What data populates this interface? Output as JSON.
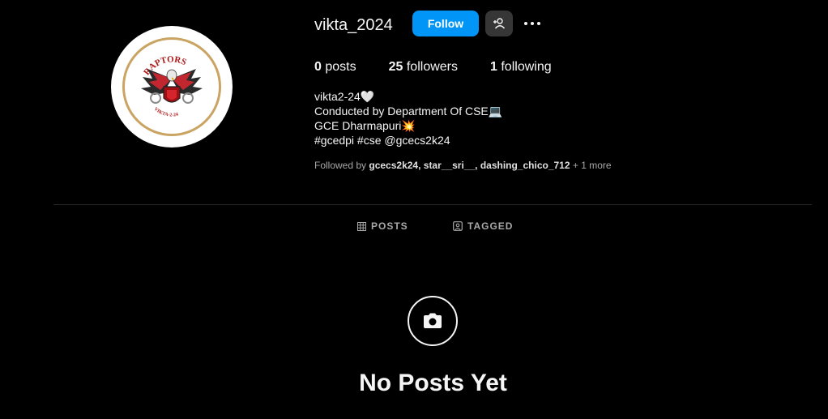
{
  "profile": {
    "username": "vikta_2024",
    "follow_label": "Follow",
    "avatar_text_top": "RAPTORS",
    "avatar_text_bottom": "VIKTA-2-24"
  },
  "stats": {
    "posts_count": "0",
    "posts_label": "posts",
    "followers_count": "25",
    "followers_label": "followers",
    "following_count": "1",
    "following_label": "following"
  },
  "bio": {
    "lines": [
      "vikta2-24🤍",
      "Conducted by Department Of CSE💻",
      "GCE Dharmapuri💥",
      "#gcedpi #cse @gcecs2k24"
    ]
  },
  "mutual": {
    "prefix": "Followed by ",
    "names": "gcecs2k24, star__sri__, dashing_chico_712",
    "suffix": " + 1 more"
  },
  "tabs": {
    "posts_label": "POSTS",
    "tagged_label": "TAGGED"
  },
  "empty_state": {
    "title": "No Posts Yet"
  },
  "icons": {
    "suggest": "person-add-icon",
    "more": "more-horizontal-icon",
    "posts_tab": "grid-icon",
    "tagged_tab": "tag-user-icon",
    "empty": "camera-icon"
  },
  "colors": {
    "background": "#000000",
    "follow_button": "#0095f6",
    "secondary_button": "#363636",
    "muted_text": "#a8a8a8",
    "divider": "#262626",
    "avatar_ring": "#c9a463"
  }
}
